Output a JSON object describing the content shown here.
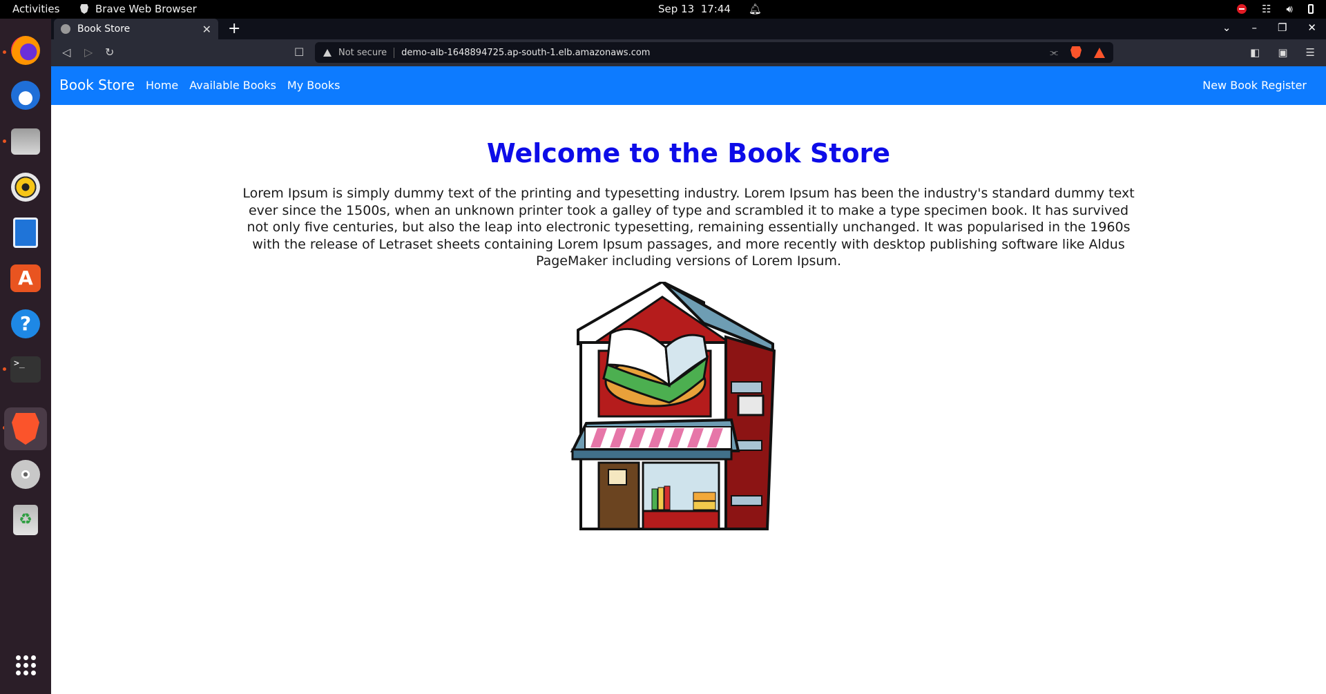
{
  "system": {
    "activities": "Activities",
    "app_name": "Brave Web Browser",
    "date": "Sep 13",
    "time": "17:44"
  },
  "dock": {
    "items": [
      "firefox",
      "thunderbird",
      "files",
      "rhythmbox",
      "libreoffice-writer",
      "app-center",
      "help",
      "terminal",
      "brave",
      "dvd",
      "trash",
      "show-apps"
    ]
  },
  "browser": {
    "tab_title": "Book Store",
    "not_secure": "Not secure",
    "url": "demo-alb-1648894725.ap-south-1.elb.amazonaws.com"
  },
  "navbar": {
    "brand": "Book Store",
    "links": [
      "Home",
      "Available Books",
      "My Books"
    ],
    "register": "New Book Register",
    "color": "#0d7bff"
  },
  "main": {
    "heading": "Welcome to the Book Store",
    "paragraph": "Lorem Ipsum is simply dummy text of the printing and typesetting industry. Lorem Ipsum has been the industry's standard dummy text ever since the 1500s, when an unknown printer took a galley of type and scrambled it to make a type specimen book. It has survived not only five centuries, but also the leap into electronic typesetting, remaining essentially unchanged. It was popularised in the 1960s with the release of Letraset sheets containing Lorem Ipsum passages, and more recently with desktop publishing software like Aldus PageMaker including versions of Lorem Ipsum.",
    "heading_color": "#0d0ce8"
  }
}
